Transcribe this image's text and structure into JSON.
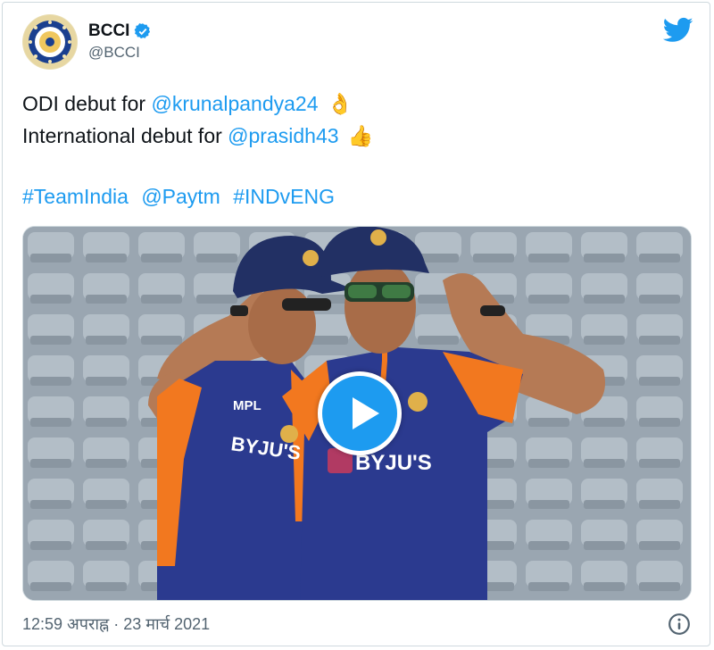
{
  "tweet": {
    "author_name": "BCCI",
    "author_handle": "@BCCI",
    "line1_prefix": "ODI debut for ",
    "line1_mention": "@krunalpandya24",
    "line1_emoji": "👌",
    "line2_prefix": "International debut for ",
    "line2_mention": "@prasidh43",
    "line2_emoji": "👍",
    "hashtags": [
      "#TeamIndia",
      "@Paytm",
      "#INDvENG"
    ],
    "timestamp": "12:59 अपराह्न · 23 मार्च 2021"
  },
  "media": {
    "jersey_text_left": "MPL",
    "sponsor_left": "BYJU'S",
    "sponsor_right": "BYJU'S"
  },
  "icons": {
    "verified": "verified-badge-icon",
    "twitter": "twitter-bird-icon",
    "play": "play-icon",
    "info": "info-icon"
  },
  "colors": {
    "accent": "#1d9bf0",
    "jersey_blue": "#2b3a8f",
    "jersey_orange": "#f2781f"
  }
}
